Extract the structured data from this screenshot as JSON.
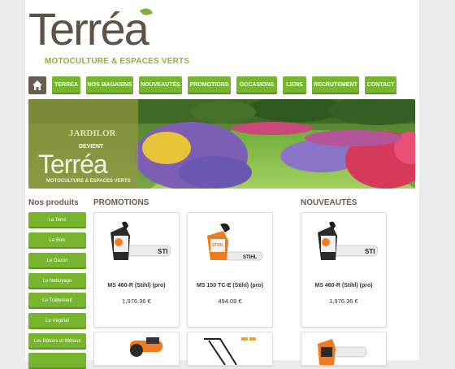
{
  "logo": {
    "word": "Terréa",
    "tagline": "MOTOCULTURE & ESPACES VERTS"
  },
  "nav": {
    "items": [
      "TERREA",
      "NOS MAGASINS",
      "NOUVEAUTÉS",
      "PROMOTIONS",
      "OCCASIONS",
      "LIENS",
      "RECRUTEMENT",
      "CONTACT"
    ]
  },
  "banner": {
    "old_brand": "JARDILOR",
    "devient": "DEVIENT",
    "new_brand": "Terréa",
    "new_tagline": "MOTOCULTURE & ESPACES VERTS"
  },
  "sidebar": {
    "title": "Nos produits",
    "items": [
      "La Terre",
      "Le Bois",
      "Le Gazon",
      "Le Nettoyage",
      "Le Traitement",
      "Le Végétal",
      "Les Bâtons et Métaux"
    ]
  },
  "promotions": {
    "title": "PROMOTIONS",
    "products": [
      {
        "name": "MS 460-R (Stihl) (pro)",
        "price": "1,976.36 €"
      },
      {
        "name": "MS 150 TC-E (Stihl) (pro)",
        "price": "494.09 €"
      }
    ]
  },
  "nouveautes": {
    "title": "NOUVEAUTÉS",
    "products": [
      {
        "name": "MS 460-R (Stihl) (pro)",
        "price": "1,976.36 €"
      }
    ]
  },
  "colors": {
    "green": "#77b52e",
    "brown": "#6a5c50",
    "tagline_green": "#8cb33c"
  }
}
